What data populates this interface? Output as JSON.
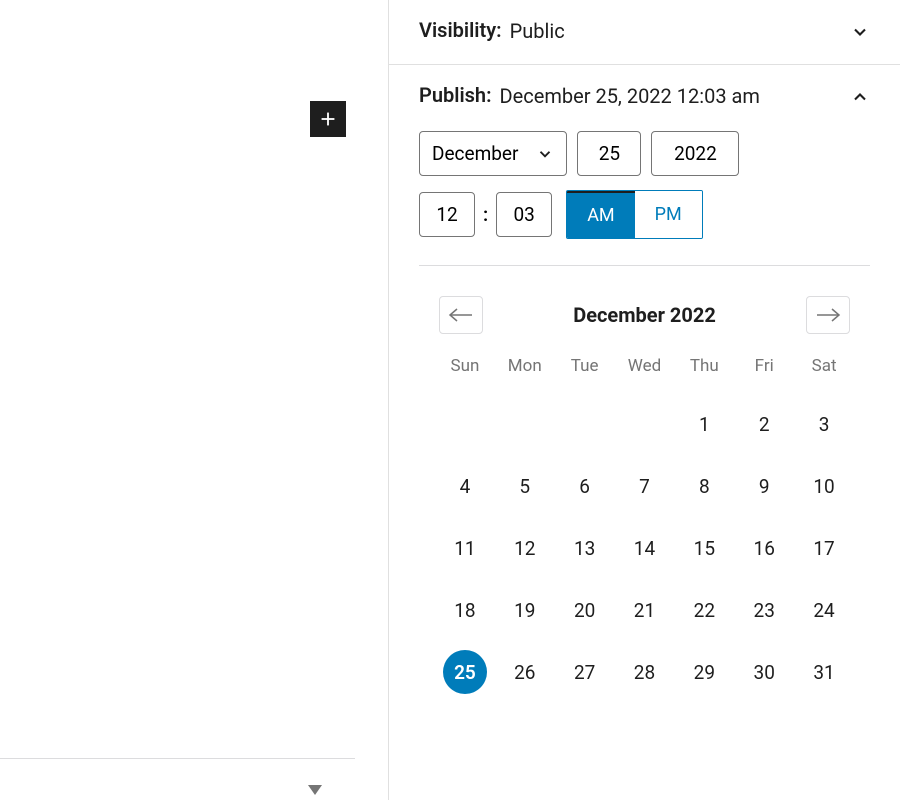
{
  "visibility": {
    "label": "Visibility:",
    "value": "Public"
  },
  "publish": {
    "label": "Publish:",
    "value": "December 25, 2022 12:03 am"
  },
  "date_inputs": {
    "month": "December",
    "day": "25",
    "year": "2022",
    "hour": "12",
    "minute": "03",
    "am_label": "AM",
    "pm_label": "PM",
    "am_active": true
  },
  "calendar": {
    "title": "December 2022",
    "weekdays": [
      "Sun",
      "Mon",
      "Tue",
      "Wed",
      "Thu",
      "Fri",
      "Sat"
    ],
    "leading_blanks": 4,
    "days_in_month": 31,
    "selected_day": 25
  }
}
